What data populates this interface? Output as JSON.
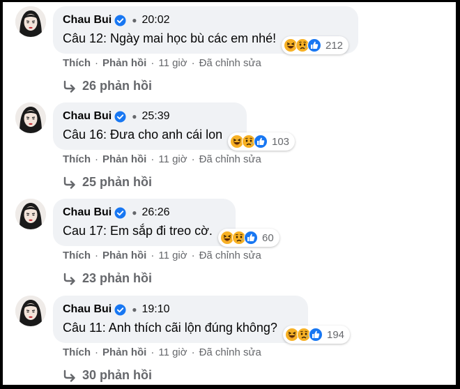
{
  "comments": [
    {
      "name": "Chau Bui",
      "time": "20:02",
      "text": "Câu 12: Ngày mai học bù các em nhé!",
      "reaction_count": "212",
      "actions": {
        "like": "Thích",
        "reply": "Phản hồi",
        "ago": "11 giờ",
        "edited": "Đã chỉnh sửa"
      },
      "replies": "26 phản hồi"
    },
    {
      "name": "Chau Bui",
      "time": "25:39",
      "text": "Câu 16: Đưa cho anh cái lon",
      "reaction_count": "103",
      "actions": {
        "like": "Thích",
        "reply": "Phản hồi",
        "ago": "11 giờ",
        "edited": "Đã chỉnh sửa"
      },
      "replies": "25 phản hồi"
    },
    {
      "name": "Chau Bui",
      "time": "26:26",
      "text": "Cau 17: Em sắp đi treo cờ.",
      "reaction_count": "60",
      "actions": {
        "like": "Thích",
        "reply": "Phản hồi",
        "ago": "11 giờ",
        "edited": "Đã chỉnh sửa"
      },
      "replies": "23 phản hồi"
    },
    {
      "name": "Chau Bui",
      "time": "19:10",
      "text": "Câu 11: Anh thích cãi lộn đúng không?",
      "reaction_count": "194",
      "actions": {
        "like": "Thích",
        "reply": "Phản hồi",
        "ago": "11 giờ",
        "edited": "Đã chỉnh sửa"
      },
      "replies": "30 phản hồi"
    }
  ],
  "reaction_icons": [
    "haha-icon",
    "sad-icon",
    "like-icon"
  ],
  "colors": {
    "bubble": "#f0f2f5",
    "verified": "#1877f2",
    "secondary_text": "#65676b",
    "like": "#1877f2",
    "emoji": "#f7b125"
  }
}
